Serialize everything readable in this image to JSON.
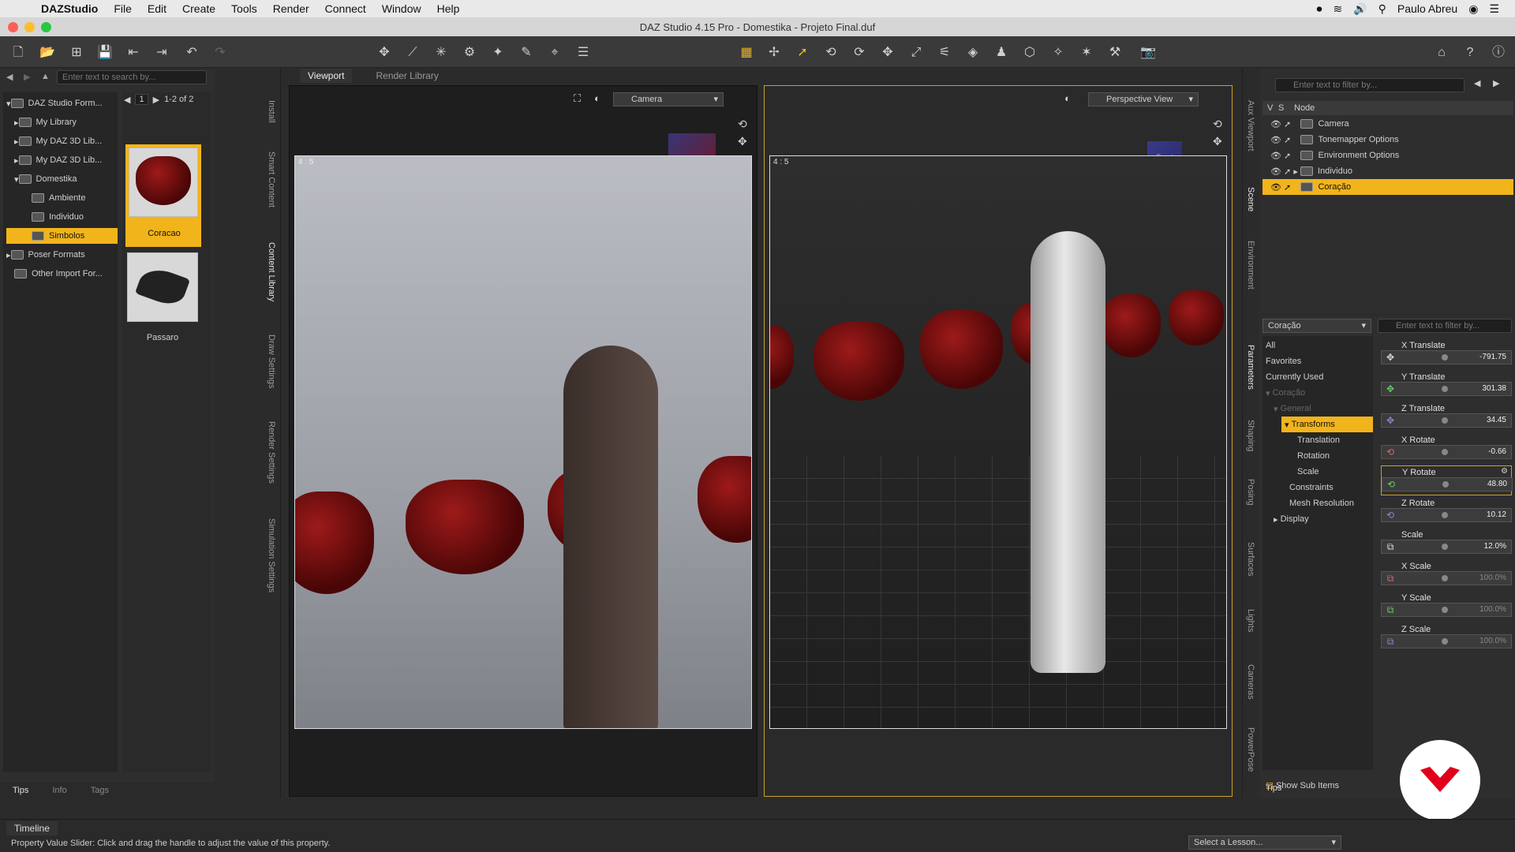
{
  "menubar": {
    "app": "DAZStudio",
    "items": [
      "File",
      "Edit",
      "Create",
      "Tools",
      "Render",
      "Connect",
      "Window",
      "Help"
    ],
    "user": "Paulo Abreu"
  },
  "window": {
    "title": "DAZ Studio 4.15 Pro - Domestika - Projeto Final.duf"
  },
  "content_library": {
    "search_placeholder": "Enter text to search by...",
    "page": "1",
    "page_count": "1-2 of 2",
    "tree": [
      {
        "label": "DAZ Studio Form..."
      },
      {
        "label": "My Library"
      },
      {
        "label": "My DAZ 3D Lib..."
      },
      {
        "label": "My DAZ 3D Lib..."
      },
      {
        "label": "Domestika"
      },
      {
        "label": "Ambiente"
      },
      {
        "label": "Individuo"
      },
      {
        "label": "Simbolos"
      },
      {
        "label": "Poser Formats"
      },
      {
        "label": "Other Import For..."
      }
    ],
    "items": [
      {
        "label": "Coracao"
      },
      {
        "label": "Passaro"
      }
    ],
    "bottom_tabs": [
      "Tips",
      "Info",
      "Tags"
    ]
  },
  "left_vtabs": [
    "Install",
    "Smart Content",
    "Content Library",
    "Draw Settings",
    "Render Settings",
    "Simulation Settings"
  ],
  "viewport": {
    "tabs": [
      "Viewport",
      "Render Library"
    ],
    "camera_left": "Camera",
    "camera_right": "Perspective View",
    "aspect": "4 : 5",
    "cube_label": "Front"
  },
  "scene": {
    "search_placeholder": "Enter text to filter by...",
    "headers": [
      "V",
      "S",
      "Node"
    ],
    "nodes": [
      "Camera",
      "Tonemapper Options",
      "Environment Options",
      "Individuo",
      "Coração"
    ]
  },
  "right_vtabs_top": [
    "Aux Viewport",
    "Scene",
    "Environment"
  ],
  "right_vtabs_bottom": [
    "Parameters",
    "Shaping",
    "Posing",
    "Surfaces",
    "Lights",
    "Cameras",
    "PowerPose"
  ],
  "parameters": {
    "node_select": "Coração",
    "filter_placeholder": "Enter text to filter by...",
    "groups": [
      "All",
      "Favorites",
      "Currently Used",
      "Coração",
      "General",
      "Transforms",
      "Translation",
      "Rotation",
      "Scale",
      "Constraints",
      "Mesh Resolution",
      "Display"
    ],
    "show_sub_items": "Show Sub Items",
    "props": [
      {
        "label": "X Translate",
        "value": "-791.75"
      },
      {
        "label": "Y Translate",
        "value": "301.38"
      },
      {
        "label": "Z Translate",
        "value": "34.45"
      },
      {
        "label": "X Rotate",
        "value": "-0.66"
      },
      {
        "label": "Y Rotate",
        "value": "48.80"
      },
      {
        "label": "Z Rotate",
        "value": "10.12"
      },
      {
        "label": "Scale",
        "value": "12.0%"
      },
      {
        "label": "X Scale",
        "value": "100.0%"
      },
      {
        "label": "Y Scale",
        "value": "100.0%"
      },
      {
        "label": "Z Scale",
        "value": "100.0%"
      }
    ],
    "tips_tab": "Tips"
  },
  "status": {
    "timeline_tab": "Timeline",
    "message": "Property Value Slider: Click and drag the handle to adjust the value of this property.",
    "lesson_select": "Select a Lesson..."
  }
}
